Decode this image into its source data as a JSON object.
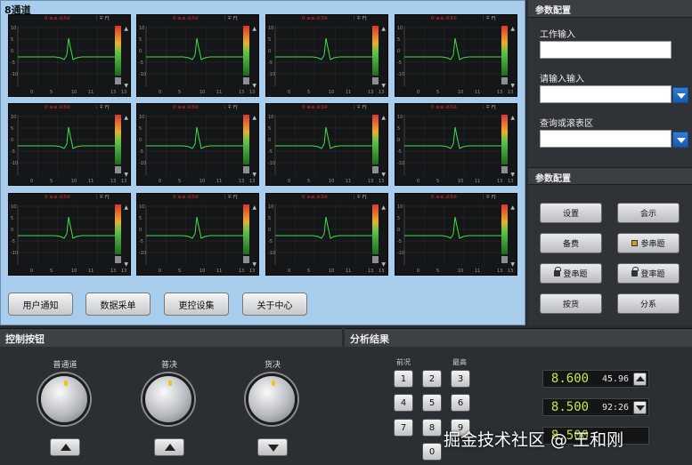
{
  "channels": {
    "title": "8通道",
    "scope_status": "0 ≥≤.⊘3⊘",
    "scope_status_right": "⋮∓ F⁅",
    "axis_x": [
      "0",
      "5",
      "10",
      "11",
      "13",
      "13"
    ],
    "axis_y": [
      "10",
      "5",
      "0",
      "-5",
      "-10"
    ],
    "count": 12
  },
  "bottom_buttons": [
    "用户通知",
    "数据采单",
    "更控设集",
    "关于中心"
  ],
  "config": {
    "header1": "参数配置",
    "field1_label": "工作输入",
    "field1_value": "",
    "field2_label": "请输入输入",
    "field2_value": "",
    "field3_label": "查询或滚表区",
    "field3_value": "",
    "header2": "参数配置",
    "buttons": [
      {
        "label": "设置",
        "icon": ""
      },
      {
        "label": "会示",
        "icon": ""
      },
      {
        "label": "备费",
        "icon": ""
      },
      {
        "label": "参串题",
        "icon": "indicator"
      },
      {
        "label": "登串题",
        "icon": "lock"
      },
      {
        "label": "登率题",
        "icon": "lock"
      },
      {
        "label": "按货",
        "icon": ""
      },
      {
        "label": "分系",
        "icon": ""
      }
    ]
  },
  "control": {
    "title": "控制按钮",
    "knobs": [
      "普通道",
      "普决",
      "货决"
    ]
  },
  "analysis": {
    "title": "分析结果",
    "col_labels": [
      "前况",
      "最高"
    ],
    "keys": [
      "1",
      "2",
      "3",
      "4",
      "5",
      "6",
      "7",
      "8",
      "9",
      "0"
    ],
    "readouts": [
      {
        "value": "8.600",
        "secondary": "45.96"
      },
      {
        "value": "8.500",
        "secondary": "92:26"
      },
      {
        "value": "8.500",
        "secondary": "—"
      }
    ]
  },
  "watermark": "掘金技术社区 @ 王和刚"
}
